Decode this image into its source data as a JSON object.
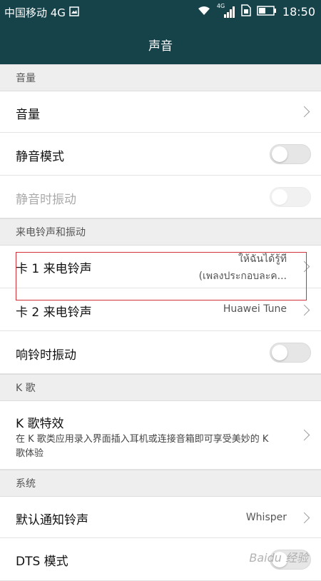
{
  "status_bar": {
    "carrier": "中国移动 4G",
    "network_small": "4G",
    "time": "18:50"
  },
  "header": {
    "title": "声音"
  },
  "sections": {
    "volume": "音量",
    "ring": "来电铃声和振动",
    "karaoke": "K 歌",
    "system": "系统"
  },
  "rows": {
    "volume": {
      "label": "音量"
    },
    "mute": {
      "label": "静音模式"
    },
    "mute_vibrate": {
      "label": "静音时振动"
    },
    "sim1_ringtone": {
      "label": "卡 1 来电铃声",
      "value_line1": "ให้ฉันได้รู้ที",
      "value_line2": "(เพลงประกอบละค..."
    },
    "sim2_ringtone": {
      "label": "卡 2 来电铃声",
      "value": "Huawei Tune"
    },
    "ring_vibrate": {
      "label": "响铃时振动"
    },
    "karaoke_effect": {
      "label": "K 歌特效",
      "desc": "在 K 歌类应用录入界面插入耳机或连接音箱即可享受美妙的 K 歌体验"
    },
    "default_notification": {
      "label": "默认通知铃声",
      "value": "Whisper"
    },
    "dts": {
      "label": "DTS 模式"
    }
  },
  "watermark": "Baidu 经验",
  "colors": {
    "header_bg": "#16424a",
    "highlight": "#d2313a"
  }
}
